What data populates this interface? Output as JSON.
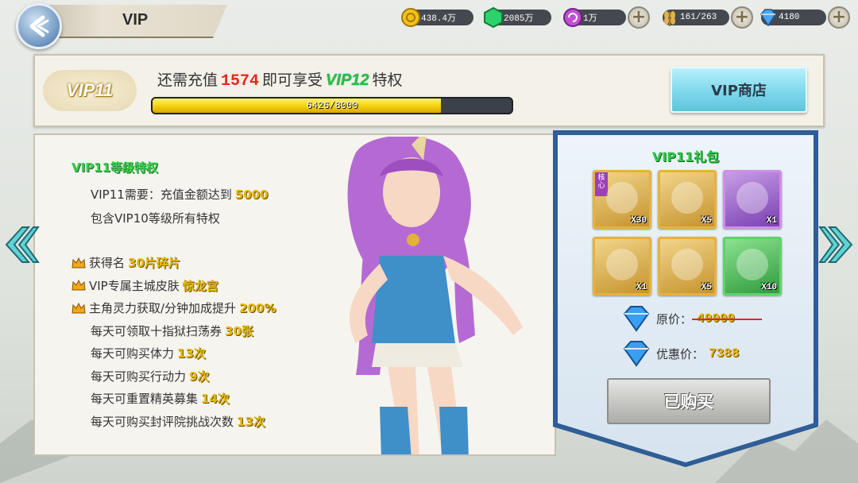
{
  "header": {
    "title": "VIP"
  },
  "resources": [
    {
      "name": "gold",
      "value": "438.4万",
      "icon": "gold-coin-icon",
      "color": "#f3c21a"
    },
    {
      "name": "jade",
      "value": "2085万",
      "icon": "green-gem-icon",
      "color": "#2ed26b"
    },
    {
      "name": "orb",
      "value": "1万",
      "icon": "purple-orb-icon",
      "color": "#c14fd6"
    },
    {
      "name": "stamina",
      "value": "161/263",
      "icon": "wheat-icon",
      "color": "#e1b446"
    },
    {
      "name": "diamond",
      "value": "4180",
      "icon": "diamond-icon",
      "color": "#4aa6ee"
    }
  ],
  "vip": {
    "badge": "VIP11",
    "recharge_prefix": "还需充值",
    "recharge_amount": "1574",
    "recharge_mid": "即可享受",
    "next_level": "VIP12",
    "recharge_suffix": "特权",
    "progress_text": "6426/8000",
    "progress_fraction": 0.80325,
    "shop_label": "VIP商店"
  },
  "privileges": {
    "title": "VIP11等级特权",
    "requirement_prefix": "VIP11需要：充值金额达到",
    "requirement_value": "5000",
    "includes": "包含VIP10等级所有特权",
    "items": [
      {
        "text": "获得名",
        "value": "30片碎片",
        "crown": true
      },
      {
        "text": "VIP专属主城皮肤",
        "value": "惊龙宫",
        "crown": true
      },
      {
        "text": "主角灵力获取/分钟加成提升",
        "value": "200%",
        "crown": true
      },
      {
        "text": "每天可领取十指狱扫荡券",
        "value": "30张",
        "crown": false
      },
      {
        "text": "每天可购买体力",
        "value": "13次",
        "crown": false
      },
      {
        "text": "每天可购买行动力",
        "value": "9次",
        "crown": false
      },
      {
        "text": "每天可重置精英募集",
        "value": "14次",
        "crown": false
      },
      {
        "text": "每天可购买封评院挑战次数",
        "value": "13次",
        "crown": false
      }
    ]
  },
  "gift": {
    "title": "VIP11礼包",
    "items": [
      {
        "name": "hero-fragment",
        "count": "X30",
        "style": "gold",
        "tag": "核心"
      },
      {
        "name": "purple-chest",
        "count": "X5",
        "style": "gold",
        "tag": ""
      },
      {
        "name": "armor-set",
        "count": "X1",
        "style": "purple",
        "tag": ""
      },
      {
        "name": "red-bag",
        "count": "X1",
        "style": "gold",
        "tag": ""
      },
      {
        "name": "green-bag",
        "count": "X5",
        "style": "gold",
        "tag": ""
      },
      {
        "name": "jade-orb",
        "count": "X10",
        "style": "green",
        "tag": ""
      }
    ],
    "original_label": "原价：",
    "original_price": "40000",
    "discount_label": "优惠价：",
    "discount_price": "7388",
    "button_label": "已购买"
  }
}
